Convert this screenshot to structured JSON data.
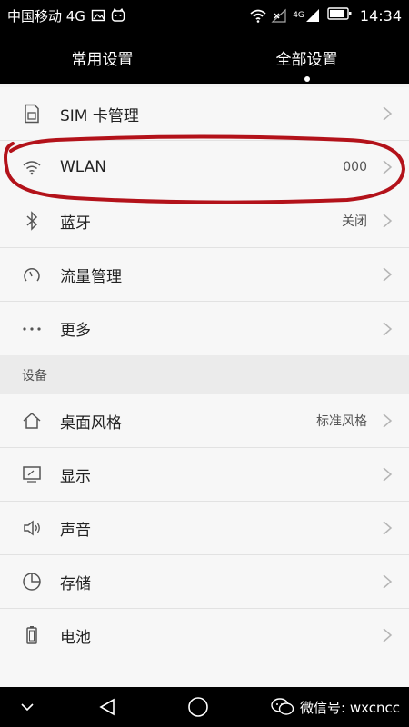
{
  "status_bar": {
    "carrier": "中国移动 4G",
    "net_label": "4G",
    "time": "14:34"
  },
  "tabs": [
    {
      "label": "常用设置",
      "active": false
    },
    {
      "label": "全部设置",
      "active": true
    }
  ],
  "wireless": [
    {
      "label": "SIM 卡管理",
      "icon": "sim-card-icon",
      "value": ""
    },
    {
      "label": "WLAN",
      "icon": "wifi-icon",
      "value": "000"
    },
    {
      "label": "蓝牙",
      "icon": "bluetooth-icon",
      "value": "关闭"
    },
    {
      "label": "流量管理",
      "icon": "gauge-icon",
      "value": ""
    },
    {
      "label": "更多",
      "icon": "more-dots-icon",
      "value": ""
    }
  ],
  "device_section": {
    "title": "设备",
    "items": [
      {
        "label": "桌面风格",
        "icon": "home-icon",
        "value": "标准风格"
      },
      {
        "label": "显示",
        "icon": "display-icon",
        "value": ""
      },
      {
        "label": "声音",
        "icon": "speaker-icon",
        "value": ""
      },
      {
        "label": "存储",
        "icon": "storage-pie-icon",
        "value": ""
      },
      {
        "label": "电池",
        "icon": "battery-icon",
        "value": ""
      }
    ]
  },
  "watermark": {
    "text": "微信号: wxcncc"
  },
  "colors": {
    "bar_bg": "#000000",
    "list_bg": "#f7f7f7",
    "highlight_stroke": "#b3121a"
  }
}
